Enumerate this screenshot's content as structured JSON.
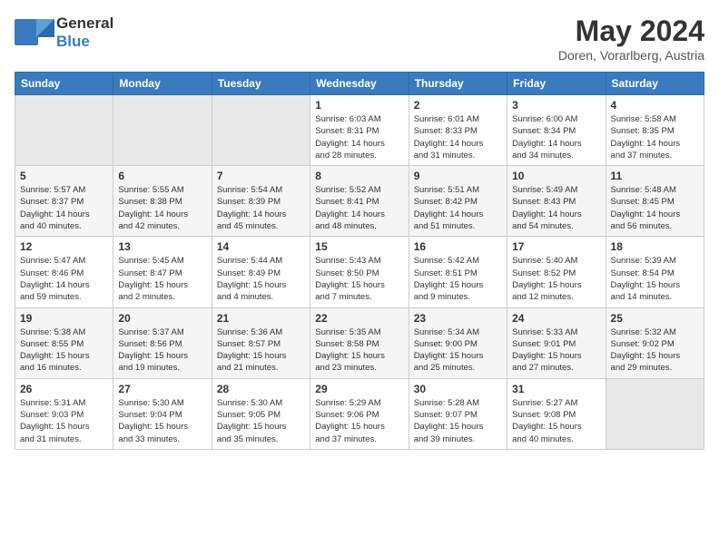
{
  "header": {
    "logo_line1": "General",
    "logo_line2": "Blue",
    "month": "May 2024",
    "location": "Doren, Vorarlberg, Austria"
  },
  "weekdays": [
    "Sunday",
    "Monday",
    "Tuesday",
    "Wednesday",
    "Thursday",
    "Friday",
    "Saturday"
  ],
  "weeks": [
    [
      {
        "day": "",
        "info": ""
      },
      {
        "day": "",
        "info": ""
      },
      {
        "day": "",
        "info": ""
      },
      {
        "day": "1",
        "info": "Sunrise: 6:03 AM\nSunset: 8:31 PM\nDaylight: 14 hours\nand 28 minutes."
      },
      {
        "day": "2",
        "info": "Sunrise: 6:01 AM\nSunset: 8:33 PM\nDaylight: 14 hours\nand 31 minutes."
      },
      {
        "day": "3",
        "info": "Sunrise: 6:00 AM\nSunset: 8:34 PM\nDaylight: 14 hours\nand 34 minutes."
      },
      {
        "day": "4",
        "info": "Sunrise: 5:58 AM\nSunset: 8:35 PM\nDaylight: 14 hours\nand 37 minutes."
      }
    ],
    [
      {
        "day": "5",
        "info": "Sunrise: 5:57 AM\nSunset: 8:37 PM\nDaylight: 14 hours\nand 40 minutes."
      },
      {
        "day": "6",
        "info": "Sunrise: 5:55 AM\nSunset: 8:38 PM\nDaylight: 14 hours\nand 42 minutes."
      },
      {
        "day": "7",
        "info": "Sunrise: 5:54 AM\nSunset: 8:39 PM\nDaylight: 14 hours\nand 45 minutes."
      },
      {
        "day": "8",
        "info": "Sunrise: 5:52 AM\nSunset: 8:41 PM\nDaylight: 14 hours\nand 48 minutes."
      },
      {
        "day": "9",
        "info": "Sunrise: 5:51 AM\nSunset: 8:42 PM\nDaylight: 14 hours\nand 51 minutes."
      },
      {
        "day": "10",
        "info": "Sunrise: 5:49 AM\nSunset: 8:43 PM\nDaylight: 14 hours\nand 54 minutes."
      },
      {
        "day": "11",
        "info": "Sunrise: 5:48 AM\nSunset: 8:45 PM\nDaylight: 14 hours\nand 56 minutes."
      }
    ],
    [
      {
        "day": "12",
        "info": "Sunrise: 5:47 AM\nSunset: 8:46 PM\nDaylight: 14 hours\nand 59 minutes."
      },
      {
        "day": "13",
        "info": "Sunrise: 5:45 AM\nSunset: 8:47 PM\nDaylight: 15 hours\nand 2 minutes."
      },
      {
        "day": "14",
        "info": "Sunrise: 5:44 AM\nSunset: 8:49 PM\nDaylight: 15 hours\nand 4 minutes."
      },
      {
        "day": "15",
        "info": "Sunrise: 5:43 AM\nSunset: 8:50 PM\nDaylight: 15 hours\nand 7 minutes."
      },
      {
        "day": "16",
        "info": "Sunrise: 5:42 AM\nSunset: 8:51 PM\nDaylight: 15 hours\nand 9 minutes."
      },
      {
        "day": "17",
        "info": "Sunrise: 5:40 AM\nSunset: 8:52 PM\nDaylight: 15 hours\nand 12 minutes."
      },
      {
        "day": "18",
        "info": "Sunrise: 5:39 AM\nSunset: 8:54 PM\nDaylight: 15 hours\nand 14 minutes."
      }
    ],
    [
      {
        "day": "19",
        "info": "Sunrise: 5:38 AM\nSunset: 8:55 PM\nDaylight: 15 hours\nand 16 minutes."
      },
      {
        "day": "20",
        "info": "Sunrise: 5:37 AM\nSunset: 8:56 PM\nDaylight: 15 hours\nand 19 minutes."
      },
      {
        "day": "21",
        "info": "Sunrise: 5:36 AM\nSunset: 8:57 PM\nDaylight: 15 hours\nand 21 minutes."
      },
      {
        "day": "22",
        "info": "Sunrise: 5:35 AM\nSunset: 8:58 PM\nDaylight: 15 hours\nand 23 minutes."
      },
      {
        "day": "23",
        "info": "Sunrise: 5:34 AM\nSunset: 9:00 PM\nDaylight: 15 hours\nand 25 minutes."
      },
      {
        "day": "24",
        "info": "Sunrise: 5:33 AM\nSunset: 9:01 PM\nDaylight: 15 hours\nand 27 minutes."
      },
      {
        "day": "25",
        "info": "Sunrise: 5:32 AM\nSunset: 9:02 PM\nDaylight: 15 hours\nand 29 minutes."
      }
    ],
    [
      {
        "day": "26",
        "info": "Sunrise: 5:31 AM\nSunset: 9:03 PM\nDaylight: 15 hours\nand 31 minutes."
      },
      {
        "day": "27",
        "info": "Sunrise: 5:30 AM\nSunset: 9:04 PM\nDaylight: 15 hours\nand 33 minutes."
      },
      {
        "day": "28",
        "info": "Sunrise: 5:30 AM\nSunset: 9:05 PM\nDaylight: 15 hours\nand 35 minutes."
      },
      {
        "day": "29",
        "info": "Sunrise: 5:29 AM\nSunset: 9:06 PM\nDaylight: 15 hours\nand 37 minutes."
      },
      {
        "day": "30",
        "info": "Sunrise: 5:28 AM\nSunset: 9:07 PM\nDaylight: 15 hours\nand 39 minutes."
      },
      {
        "day": "31",
        "info": "Sunrise: 5:27 AM\nSunset: 9:08 PM\nDaylight: 15 hours\nand 40 minutes."
      },
      {
        "day": "",
        "info": ""
      }
    ]
  ]
}
